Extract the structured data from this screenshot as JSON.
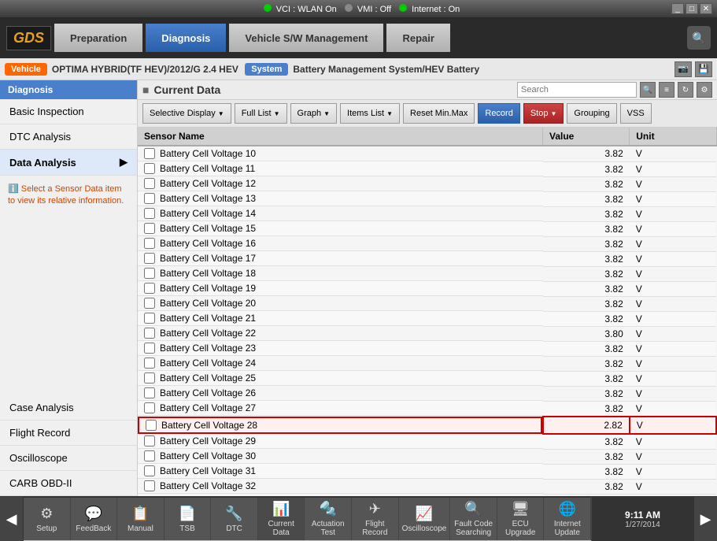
{
  "titlebar": {
    "vci_label": "VCI : WLAN On",
    "vmi_label": "VMI : Off",
    "internet_label": "Internet : On"
  },
  "nav": {
    "logo": "GDS",
    "preparation": "Preparation",
    "diagnosis": "Diagnosis",
    "vehicle_sw": "Vehicle S/W Management",
    "repair": "Repair"
  },
  "vehicle_bar": {
    "vehicle_label": "Vehicle",
    "vehicle_name": "OPTIMA HYBRID(TF HEV)/2012/G 2.4 HEV",
    "system_label": "System",
    "system_name": "Battery Management System/HEV Battery"
  },
  "sidebar": {
    "title": "Diagnosis",
    "items": [
      {
        "label": "Basic Inspection",
        "active": false
      },
      {
        "label": "DTC Analysis",
        "active": false
      },
      {
        "label": "Data Analysis",
        "active": true,
        "has_arrow": true
      },
      {
        "label": "Case Analysis",
        "active": false
      },
      {
        "label": "Flight Record",
        "active": false
      },
      {
        "label": "Oscilloscope",
        "active": false
      },
      {
        "label": "CARB OBD-II",
        "active": false
      }
    ],
    "info_text": "Select a Sensor Data item to view its relative information."
  },
  "content": {
    "title": "Current Data",
    "search_placeholder": "Search"
  },
  "toolbar": {
    "selective_display": "Selective Display",
    "full_list": "Full List",
    "graph": "Graph",
    "items_list": "Items List",
    "reset_min_max": "Reset Min.Max",
    "record": "Record",
    "stop": "Stop",
    "grouping": "Grouping",
    "vss": "VSS"
  },
  "table": {
    "headers": [
      "Sensor Name",
      "Value",
      "Unit"
    ],
    "rows": [
      {
        "name": "Battery Cell Voltage 10",
        "value": "3.82",
        "unit": "V",
        "checked": false,
        "highlighted": false
      },
      {
        "name": "Battery Cell Voltage 11",
        "value": "3.82",
        "unit": "V",
        "checked": false,
        "highlighted": false
      },
      {
        "name": "Battery Cell Voltage 12",
        "value": "3.82",
        "unit": "V",
        "checked": false,
        "highlighted": false
      },
      {
        "name": "Battery Cell Voltage 13",
        "value": "3.82",
        "unit": "V",
        "checked": false,
        "highlighted": false
      },
      {
        "name": "Battery Cell Voltage 14",
        "value": "3.82",
        "unit": "V",
        "checked": false,
        "highlighted": false
      },
      {
        "name": "Battery Cell Voltage 15",
        "value": "3.82",
        "unit": "V",
        "checked": false,
        "highlighted": false
      },
      {
        "name": "Battery Cell Voltage 16",
        "value": "3.82",
        "unit": "V",
        "checked": false,
        "highlighted": false
      },
      {
        "name": "Battery Cell Voltage 17",
        "value": "3.82",
        "unit": "V",
        "checked": false,
        "highlighted": false
      },
      {
        "name": "Battery Cell Voltage 18",
        "value": "3.82",
        "unit": "V",
        "checked": false,
        "highlighted": false
      },
      {
        "name": "Battery Cell Voltage 19",
        "value": "3.82",
        "unit": "V",
        "checked": false,
        "highlighted": false
      },
      {
        "name": "Battery Cell Voltage 20",
        "value": "3.82",
        "unit": "V",
        "checked": false,
        "highlighted": false
      },
      {
        "name": "Battery Cell Voltage 21",
        "value": "3.82",
        "unit": "V",
        "checked": false,
        "highlighted": false
      },
      {
        "name": "Battery Cell Voltage 22",
        "value": "3.80",
        "unit": "V",
        "checked": false,
        "highlighted": false
      },
      {
        "name": "Battery Cell Voltage 23",
        "value": "3.82",
        "unit": "V",
        "checked": false,
        "highlighted": false
      },
      {
        "name": "Battery Cell Voltage 24",
        "value": "3.82",
        "unit": "V",
        "checked": false,
        "highlighted": false
      },
      {
        "name": "Battery Cell Voltage 25",
        "value": "3.82",
        "unit": "V",
        "checked": false,
        "highlighted": false
      },
      {
        "name": "Battery Cell Voltage 26",
        "value": "3.82",
        "unit": "V",
        "checked": false,
        "highlighted": false
      },
      {
        "name": "Battery Cell Voltage 27",
        "value": "3.82",
        "unit": "V",
        "checked": false,
        "highlighted": false
      },
      {
        "name": "Battery Cell Voltage 28",
        "value": "2.82",
        "unit": "V",
        "checked": false,
        "highlighted": true
      },
      {
        "name": "Battery Cell Voltage 29",
        "value": "3.82",
        "unit": "V",
        "checked": false,
        "highlighted": false
      },
      {
        "name": "Battery Cell Voltage 30",
        "value": "3.82",
        "unit": "V",
        "checked": false,
        "highlighted": false
      },
      {
        "name": "Battery Cell Voltage 31",
        "value": "3.82",
        "unit": "V",
        "checked": false,
        "highlighted": false
      },
      {
        "name": "Battery Cell Voltage 32",
        "value": "3.82",
        "unit": "V",
        "checked": false,
        "highlighted": false
      }
    ]
  },
  "taskbar": {
    "items": [
      {
        "icon": "⚙",
        "label": "Setup"
      },
      {
        "icon": "◀",
        "label": ""
      },
      {
        "icon": "💬",
        "label": "FeedBack"
      },
      {
        "icon": "📋",
        "label": "Manual"
      },
      {
        "icon": "📄",
        "label": "TSB"
      },
      {
        "icon": "🔧",
        "label": "DTC"
      },
      {
        "icon": "📊",
        "label": "Current Data"
      },
      {
        "icon": "🔩",
        "label": "Actuation Test"
      },
      {
        "icon": "✈",
        "label": "Flight Record"
      },
      {
        "icon": "📈",
        "label": "Oscilloscope"
      },
      {
        "icon": "🔍",
        "label": "Fault Code Searching"
      },
      {
        "icon": "🖥",
        "label": "ECU Upgrade"
      },
      {
        "icon": "🌐",
        "label": "Internet Update"
      },
      {
        "icon": "▶",
        "label": ""
      }
    ],
    "time": "9:11 AM",
    "date": "1/27/2014"
  }
}
